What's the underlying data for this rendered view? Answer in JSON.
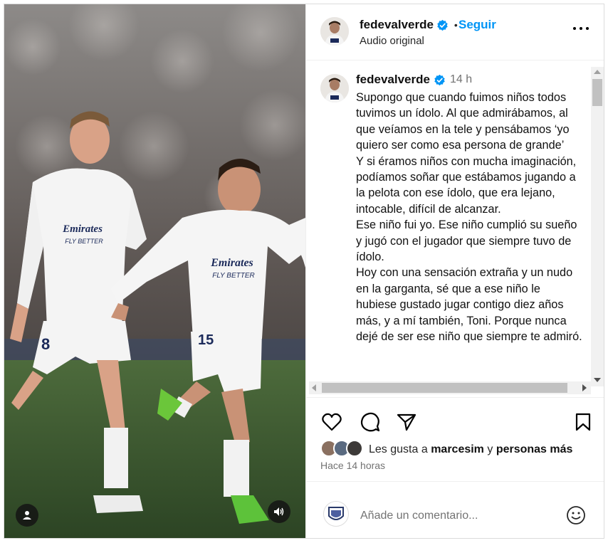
{
  "header": {
    "username": "fedevalverde",
    "follow_label": "Seguir",
    "follow_separator": "•",
    "subtitle": "Audio original"
  },
  "caption": {
    "username": "fedevalverde",
    "time": "14 h",
    "text": "Supongo que cuando fuimos niños todos tuvimos un ídolo. Al que admirábamos, al que veíamos en la tele y pensábamos ‘yo quiero ser como esa persona de grande’\nY si éramos niños con mucha imaginación, podíamos soñar que estábamos jugando a la pelota con ese ídolo, que era lejano, intocable, difícil de alcanzar.\nEse niño fui yo. Ese niño cumplió su sueño y jugó con el jugador que siempre tuvo de ídolo.\nHoy con una sensación extraña y un nudo en la garganta, sé que a ese niño le hubiese gustado jugar contigo diez años más, y a mí también, Toni. Porque nunca dejé de ser ese niño que siempre te admiró."
  },
  "likes": {
    "prefix": "Les gusta a",
    "user": "marcesim",
    "connector": "y",
    "others": "personas más"
  },
  "time_ago": "Hace 14 horas",
  "comment": {
    "placeholder": "Añade un comentario..."
  },
  "media": {
    "jersey_sponsor_line1": "Emirates",
    "jersey_sponsor_line2": "FLY BETTER",
    "left_number": "8",
    "right_number": "15"
  },
  "icons": {
    "verified": "verified-badge-icon",
    "more": "more-options-icon",
    "like": "heart-icon",
    "comment": "comment-icon",
    "share": "share-icon",
    "save": "bookmark-icon",
    "emoji": "emoji-icon",
    "user_tag": "user-tag-icon",
    "audio": "speaker-icon"
  },
  "colors": {
    "accent": "#0095f6",
    "verified": "#0095f6",
    "text_secondary": "#737373"
  }
}
